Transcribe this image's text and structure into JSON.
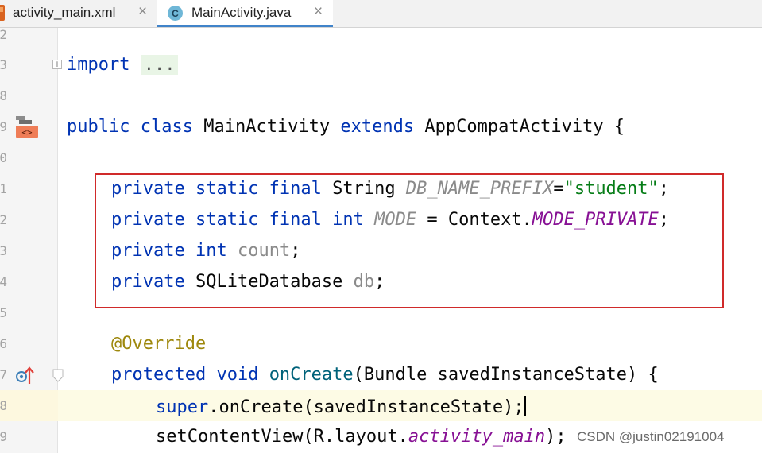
{
  "tabs": [
    {
      "label": "activity_main.xml",
      "icon": "xml-file-icon",
      "close": "×"
    },
    {
      "label": "MainActivity.java",
      "icon": "java-class-icon",
      "icon_letter": "C",
      "close": "×",
      "active": true
    }
  ],
  "gutter": {
    "line_numbers": [
      "2",
      "3",
      "8",
      "9",
      "0",
      "1",
      "2",
      "3",
      "4",
      "5",
      "6",
      "7",
      "8",
      "9"
    ]
  },
  "code": {
    "import_kw": "import",
    "import_folded": "...",
    "class_line": {
      "public": "public",
      "class": "class",
      "name": "MainActivity",
      "extends": "extends",
      "parent": "AppCompatActivity",
      "brace": " {"
    },
    "field1": {
      "mods": "private static final",
      "type": "String",
      "name": "DB_NAME_PREFIX",
      "eq": "=",
      "value": "\"student\"",
      "semi": ";"
    },
    "field2": {
      "mods": "private static final",
      "type": "int",
      "name": "MODE",
      "eq": " = ",
      "ctx": "Context.",
      "value": "MODE_PRIVATE",
      "semi": ";"
    },
    "field3": {
      "mods": "private",
      "type": "int",
      "name": "count",
      "semi": ";"
    },
    "field4": {
      "mods": "private",
      "type": "SQLiteDatabase",
      "name": "db",
      "semi": ";"
    },
    "annotation": "@Override",
    "method_line": {
      "mods": "protected void",
      "name": "onCreate",
      "params": "(Bundle savedInstanceState) {"
    },
    "super_line": {
      "kw": "super",
      "rest": ".onCreate(savedInstanceState);"
    },
    "setcontent_line": {
      "start": "setContentView(R.layout.",
      "value": "activity_main",
      "end": ");"
    }
  },
  "watermark": "CSDN @justin02191004"
}
